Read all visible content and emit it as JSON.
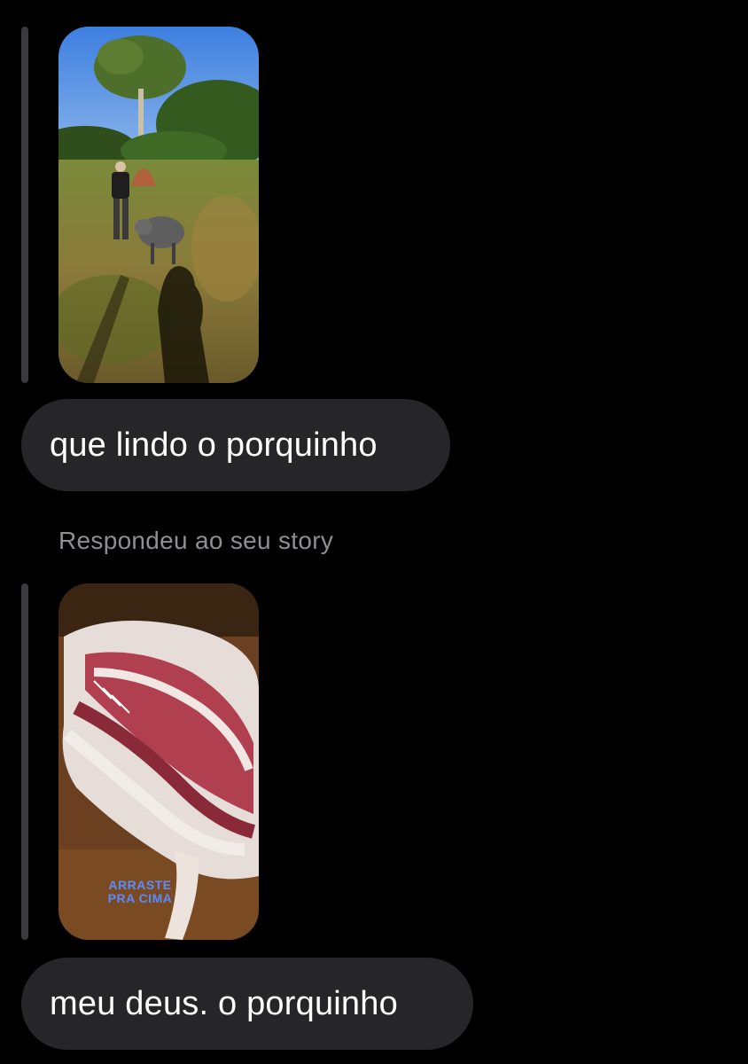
{
  "messages": [
    {
      "story": {
        "kind": "story-reply-preview",
        "scene": "farm-pig"
      },
      "text": "que lindo o porquinho"
    },
    {
      "label": "Respondeu ao seu story",
      "story": {
        "kind": "story-reply-preview",
        "scene": "meat",
        "overlay_text": "ARRASTE PRA CIMA"
      },
      "text": "meu deus. o porquinho"
    }
  ],
  "colors": {
    "background": "#000000",
    "bubble": "#262628",
    "reply_bar": "#3a3a3c",
    "label": "#8e8e93",
    "overlay_text": "#5b8cff"
  }
}
